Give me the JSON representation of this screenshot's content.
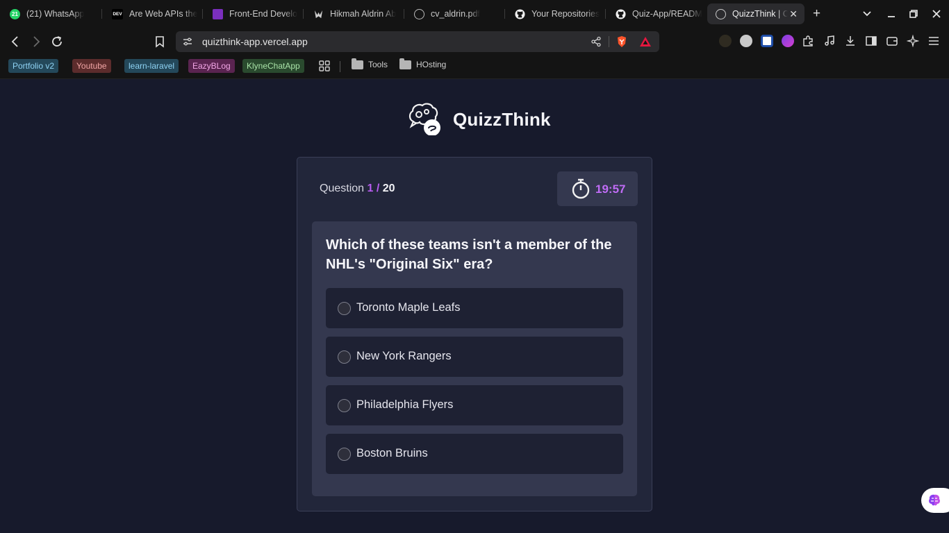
{
  "browser": {
    "tabs": [
      {
        "label": "(21) WhatsApp",
        "icon": "whatsapp-icon",
        "badge": "21"
      },
      {
        "label": "Are Web APIs the",
        "icon": "dev-icon",
        "badge": "DEV"
      },
      {
        "label": "Front-End Develo",
        "icon": "frontend-icon"
      },
      {
        "label": "Hikmah Aldrin Ab",
        "icon": "wolf-logo-icon"
      },
      {
        "label": "cv_aldrin.pdf",
        "icon": "globe-icon"
      },
      {
        "label": "Your Repositories",
        "icon": "github-icon"
      },
      {
        "label": "Quiz-App/READM",
        "icon": "github-icon"
      },
      {
        "label": "QuizzThink | C",
        "icon": "quizzthink-icon",
        "active": true
      }
    ],
    "url": "quizthink-app.vercel.app",
    "bookmarks": [
      {
        "label": "Portfolio v2",
        "bg": "#24485a",
        "fg": "#8fd3f4"
      },
      {
        "label": "Youtube",
        "bg": "#5c2c2c",
        "fg": "#f1a5a5"
      },
      {
        "label": "learn-laravel",
        "bg": "#24485a",
        "fg": "#8fd3f4"
      },
      {
        "label": "EazyBLog",
        "bg": "#5a2450",
        "fg": "#f3a6e6"
      },
      {
        "label": "KlyneChatApp",
        "bg": "#2a4a2e",
        "fg": "#a9e3a8"
      }
    ],
    "bookmark_folders": [
      "Tools",
      "HOsting"
    ]
  },
  "app": {
    "title": "QuizzThink"
  },
  "quiz": {
    "counter_prefix": "Question",
    "current": "1",
    "separator": "/",
    "total": "20",
    "timer": "19:57",
    "question": "Which of these teams isn't a member of the NHL's \"Original Six\" era?",
    "options": [
      "Toronto Maple Leafs",
      "New York Rangers",
      "Philadelphia Flyers",
      "Boston Bruins"
    ]
  },
  "colors": {
    "page_bg": "#171a2c",
    "card_bg": "#22263a",
    "panel_bg": "#34384f",
    "option_bg": "#1e2133",
    "accent": "#b85cf0"
  }
}
